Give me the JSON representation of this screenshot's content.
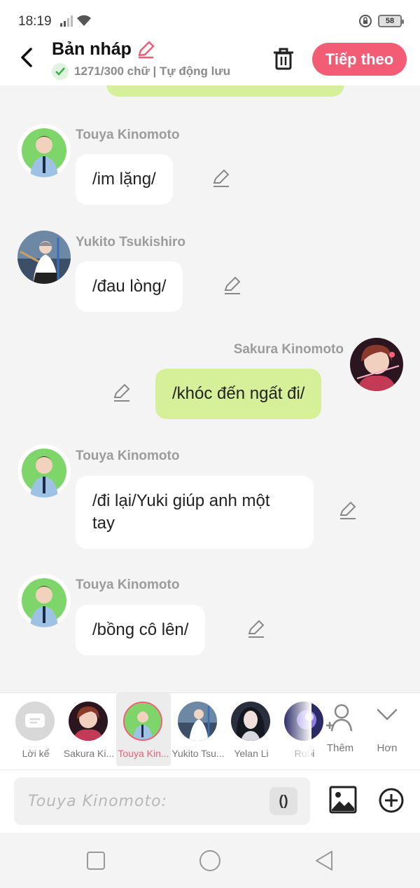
{
  "status_bar": {
    "time": "18:19",
    "battery": "58"
  },
  "header": {
    "title": "Bản nháp",
    "subtitle": "1271/300 chữ | Tự động lưu",
    "next_label": "Tiếp theo"
  },
  "messages": [
    {
      "sender": "Touya Kinomoto",
      "text": "/im lặng/",
      "side": "left"
    },
    {
      "sender": "Yukito Tsukishiro",
      "text": "/đau lòng/",
      "side": "left"
    },
    {
      "sender": "Sakura Kinomoto",
      "text": "/khóc đến ngất đi/",
      "side": "right"
    },
    {
      "sender": "Touya Kinomoto",
      "text": "/đi lại/Yuki giúp anh một tay",
      "side": "left"
    },
    {
      "sender": "Touya Kinomoto",
      "text": "/bồng cô lên/",
      "side": "left"
    }
  ],
  "characters": [
    {
      "label": "Lời kể",
      "icon": "narrator-icon"
    },
    {
      "label": "Sakura Ki...",
      "icon": "avatar"
    },
    {
      "label": "Touya Kin...",
      "icon": "avatar",
      "selected": true
    },
    {
      "label": "Yukito Tsu...",
      "icon": "avatar"
    },
    {
      "label": "Yelan Li",
      "icon": "avatar"
    },
    {
      "label": "Rubi",
      "icon": "avatar"
    }
  ],
  "tools": {
    "add_label": "Thêm",
    "more_label": "Hơn"
  },
  "input": {
    "placeholder": "Touya Kinomoto:",
    "paren_label": "()"
  },
  "colors": {
    "accent": "#f25c75",
    "my_bubble": "#d6f09a",
    "background": "#f4f4f4"
  }
}
